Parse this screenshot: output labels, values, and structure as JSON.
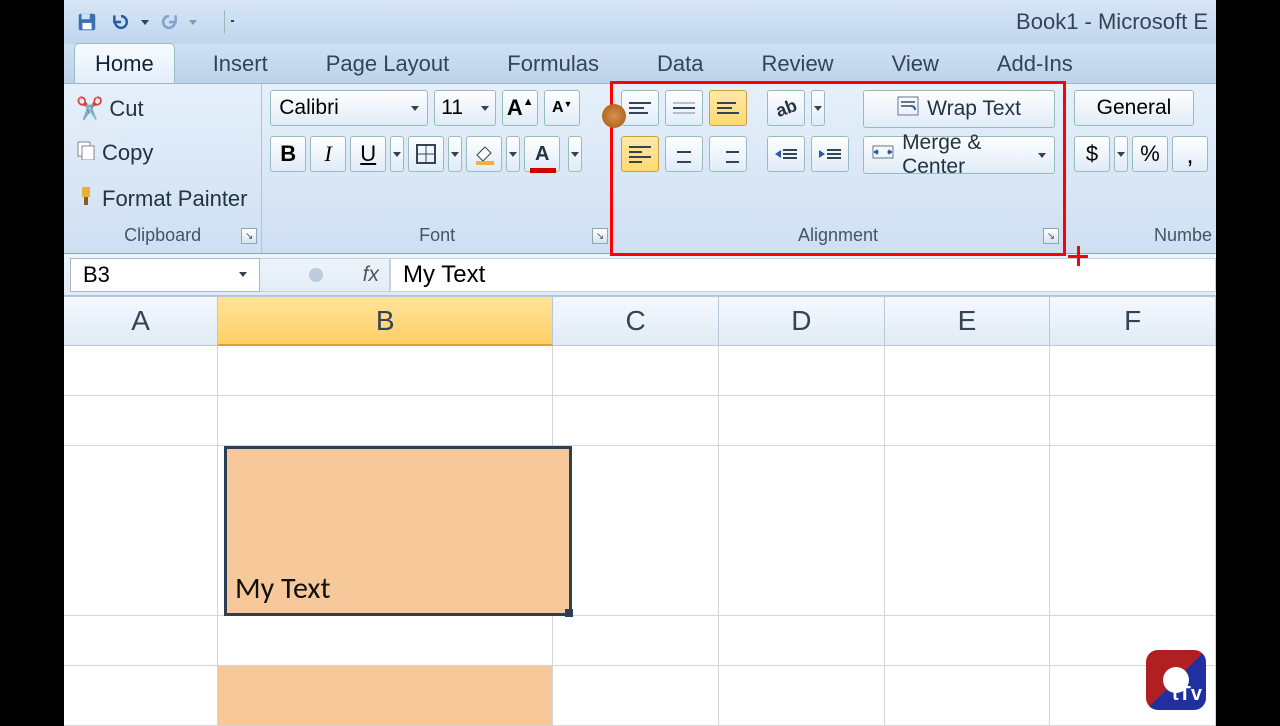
{
  "title": "Book1 - Microsoft E",
  "tabs": [
    "Home",
    "Insert",
    "Page Layout",
    "Formulas",
    "Data",
    "Review",
    "Add-Ins"
  ],
  "active_tab_index": 0,
  "view_tab": "View",
  "clipboard": {
    "cut": "Cut",
    "copy": "Copy",
    "fmt": "Format Painter",
    "label": "Clipboard"
  },
  "font": {
    "name": "Calibri",
    "size": "11",
    "label": "Font"
  },
  "alignment": {
    "wrap": "Wrap Text",
    "merge": "Merge & Center",
    "label": "Alignment"
  },
  "number": {
    "format": "General",
    "label": "Numbe"
  },
  "name_box": "B3",
  "fx": "fx",
  "formula_value": "My Text",
  "columns": [
    "A",
    "B",
    "C",
    "D",
    "E",
    "F"
  ],
  "selected_column_index": 1,
  "active_cell_text": "My Text",
  "logo_text": "tTv"
}
